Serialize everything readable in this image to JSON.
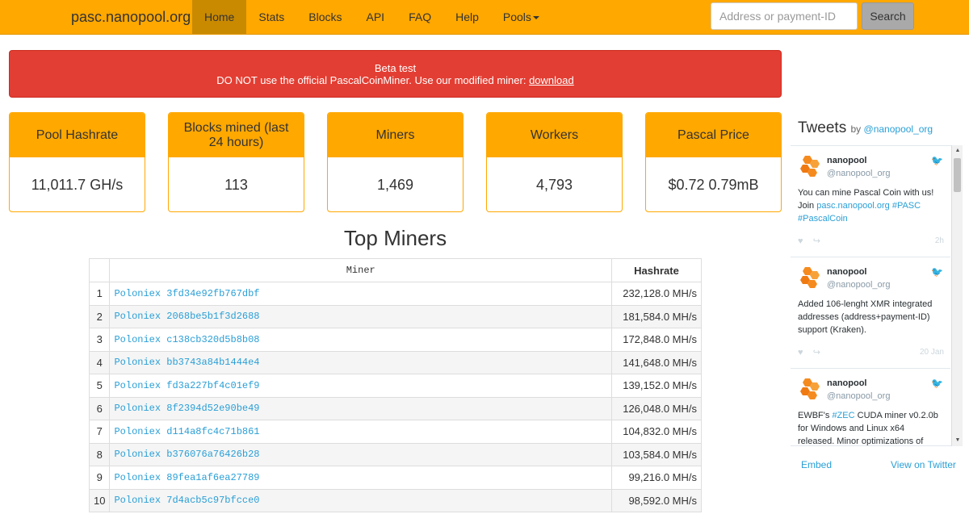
{
  "navbar": {
    "brand": "pasc.nanopool.org",
    "items": [
      {
        "label": "Home"
      },
      {
        "label": "Stats"
      },
      {
        "label": "Blocks"
      },
      {
        "label": "API"
      },
      {
        "label": "FAQ"
      },
      {
        "label": "Help"
      },
      {
        "label": "Pools"
      }
    ],
    "search_placeholder": "Address or payment-ID",
    "search_button": "Search"
  },
  "alert": {
    "line1": "Beta test",
    "line2": "DO NOT use the official PascalCoinMiner. Use our modified miner:",
    "link": "download"
  },
  "stats": [
    {
      "label": "Pool Hashrate",
      "value": "11,011.7 GH/s"
    },
    {
      "label": "Blocks mined (last 24 hours)",
      "value": "113"
    },
    {
      "label": "Miners",
      "value": "1,469"
    },
    {
      "label": "Workers",
      "value": "4,793"
    },
    {
      "label": "Pascal Price",
      "value": "$0.72 0.79mB"
    }
  ],
  "top_miners": {
    "title": "Top Miners",
    "columns": [
      "Miner",
      "Hashrate"
    ],
    "rows": [
      {
        "idx": "1",
        "miner": "Poloniex 3fd34e92fb767dbf",
        "hashrate": "232,128.0 MH/s"
      },
      {
        "idx": "2",
        "miner": "Poloniex 2068be5b1f3d2688",
        "hashrate": "181,584.0 MH/s"
      },
      {
        "idx": "3",
        "miner": "Poloniex c138cb320d5b8b08",
        "hashrate": "172,848.0 MH/s"
      },
      {
        "idx": "4",
        "miner": "Poloniex bb3743a84b1444e4",
        "hashrate": "141,648.0 MH/s"
      },
      {
        "idx": "5",
        "miner": "Poloniex fd3a227bf4c01ef9",
        "hashrate": "139,152.0 MH/s"
      },
      {
        "idx": "6",
        "miner": "Poloniex 8f2394d52e90be49",
        "hashrate": "126,048.0 MH/s"
      },
      {
        "idx": "7",
        "miner": "Poloniex d114a8fc4c71b861",
        "hashrate": "104,832.0 MH/s"
      },
      {
        "idx": "8",
        "miner": "Poloniex b376076a76426b28",
        "hashrate": "103,584.0 MH/s"
      },
      {
        "idx": "9",
        "miner": "Poloniex 89fea1af6ea27789",
        "hashrate": "99,216.0 MH/s"
      },
      {
        "idx": "10",
        "miner": "Poloniex 7d4acb5c97bfcce0",
        "hashrate": "98,592.0 MH/s"
      }
    ]
  },
  "twitter": {
    "title": "Tweets",
    "by": "by",
    "by_handle": "@nanopool_org",
    "tweets": [
      {
        "name": "nanopool",
        "handle": "@nanopool_org",
        "text_parts": [
          "You can mine Pascal Coin with us! Join ",
          "pasc.nanopool.org",
          "  ",
          "#PASC",
          " ",
          "#PascalCoin"
        ],
        "date": "2h"
      },
      {
        "name": "nanopool",
        "handle": "@nanopool_org",
        "text_parts": [
          "Added 106-lenght XMR integrated addresses (address+payment-ID) support (Kraken)."
        ],
        "date": "20 Jan"
      },
      {
        "name": "nanopool",
        "handle": "@nanopool_org",
        "text_parts": [
          "EWBF's ",
          "#ZEC",
          " CUDA miner v0.2.0b for Windows and Linux x64 released. Minor optimizations of"
        ],
        "date": ""
      }
    ],
    "embed": "Embed",
    "view_on_twitter": "View on Twitter"
  },
  "colors": {
    "accent": "#ffa800",
    "alert": "#e33e33",
    "link": "#2a9fd6"
  }
}
